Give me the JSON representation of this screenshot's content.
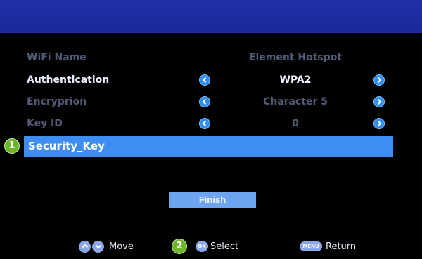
{
  "colors": {
    "top_bar": "#1f2fa6",
    "selected_row": "#3d8ef0",
    "inactive_text": "#525a78",
    "active_text": "#e8ecff",
    "step_badge": "#6eb52a",
    "arrow_button": "#2f8df4"
  },
  "settings": {
    "wifi_name": {
      "label": "WiFi Name",
      "value": "Element Hotspot"
    },
    "authentication": {
      "label": "Authentication",
      "value": "WPA2"
    },
    "encryption": {
      "label": "Encryprion",
      "value": "Character 5"
    },
    "key_id": {
      "label": "Key ID",
      "value": "0"
    },
    "security_key": {
      "label": "Security_Key"
    }
  },
  "badges": {
    "step1": "1",
    "step2": "2"
  },
  "finish_label": "Finish",
  "legend": {
    "move_label": "Move",
    "select_label": "Select",
    "ok_key": "OK",
    "return_label": "Return",
    "menu_key": "MENU"
  },
  "icons": [
    "chevron-left-icon",
    "chevron-right-icon",
    "chevron-up-icon",
    "chevron-down-icon"
  ]
}
